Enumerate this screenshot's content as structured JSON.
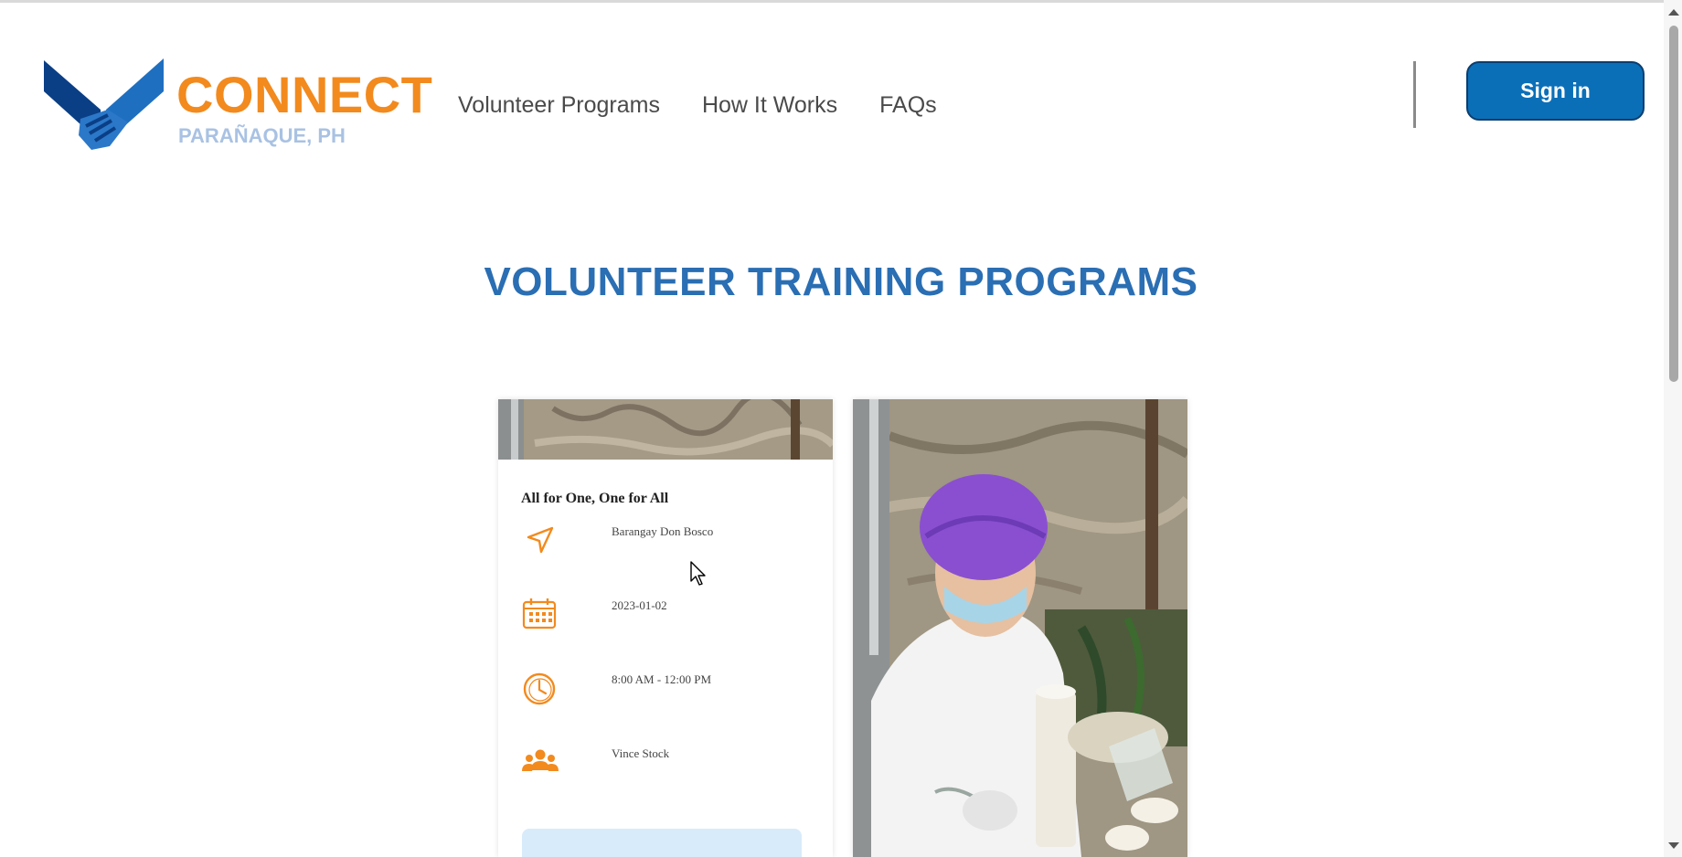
{
  "header": {
    "logo_word": "CONNECT",
    "logo_sub": "PARAÑAQUE, PH",
    "nav": [
      "Volunteer Programs",
      "How It Works",
      "FAQs"
    ],
    "signin_label": "Sign in"
  },
  "main": {
    "title": "VOLUNTEER TRAINING PROGRAMS",
    "cards": [
      {
        "title": "All for One, One for All",
        "location": "Barangay Don Bosco",
        "date": "2023-01-02",
        "time": "8:00 AM - 12:00 PM",
        "organizer": "Vince Stock"
      }
    ]
  },
  "colors": {
    "accent_orange": "#f28a1e",
    "brand_blue": "#0b6fb8",
    "title_blue": "#2a6eb3"
  },
  "icons": [
    "handshake-logo-icon",
    "location-arrow-icon",
    "calendar-icon",
    "clock-icon",
    "people-icon"
  ]
}
